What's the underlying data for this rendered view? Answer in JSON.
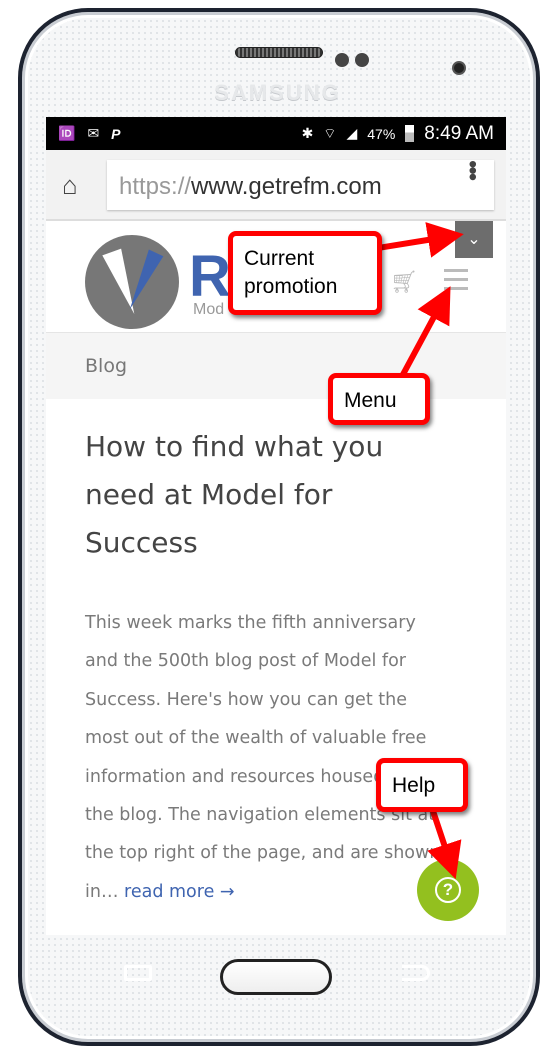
{
  "device": {
    "brand": "SAMSUNG"
  },
  "status_bar": {
    "left_icons": [
      "caller-id-icon",
      "mail-icon",
      "paypal-icon"
    ],
    "battery": "47%",
    "time": "8:49 AM",
    "right_icons": [
      "bluetooth-icon",
      "wifi-icon",
      "signal-icon",
      "battery-icon"
    ]
  },
  "browser": {
    "url_scheme": "https://",
    "url_host": "www.getrefm.com"
  },
  "site": {
    "logo_letter": "R",
    "logo_sub": "Mod",
    "promo_button_icon": "chevron-down-icon",
    "cart_icon": "cart-icon",
    "menu_icon": "hamburger-icon"
  },
  "breadcrumb": "Blog",
  "post": {
    "title_lines": [
      "How to find what you",
      "need at Model for",
      "Success"
    ],
    "excerpt_lines": [
      "This week marks the fifth anniversary",
      "and the 500th blog post of Model for",
      "Success. Here's how you can get the",
      "most out of the wealth of valuable free",
      "information and resources housed in",
      "the blog. The navigation elements sit at",
      "the top right of the page, and are shown",
      "in… "
    ],
    "read_more": "read more →"
  },
  "help_button": {
    "icon": "question-circle-icon",
    "color": "#93c01f"
  },
  "annotations": {
    "promotion": "Current promotion",
    "menu": "Menu",
    "help": "Help",
    "color": "#ff0000"
  }
}
